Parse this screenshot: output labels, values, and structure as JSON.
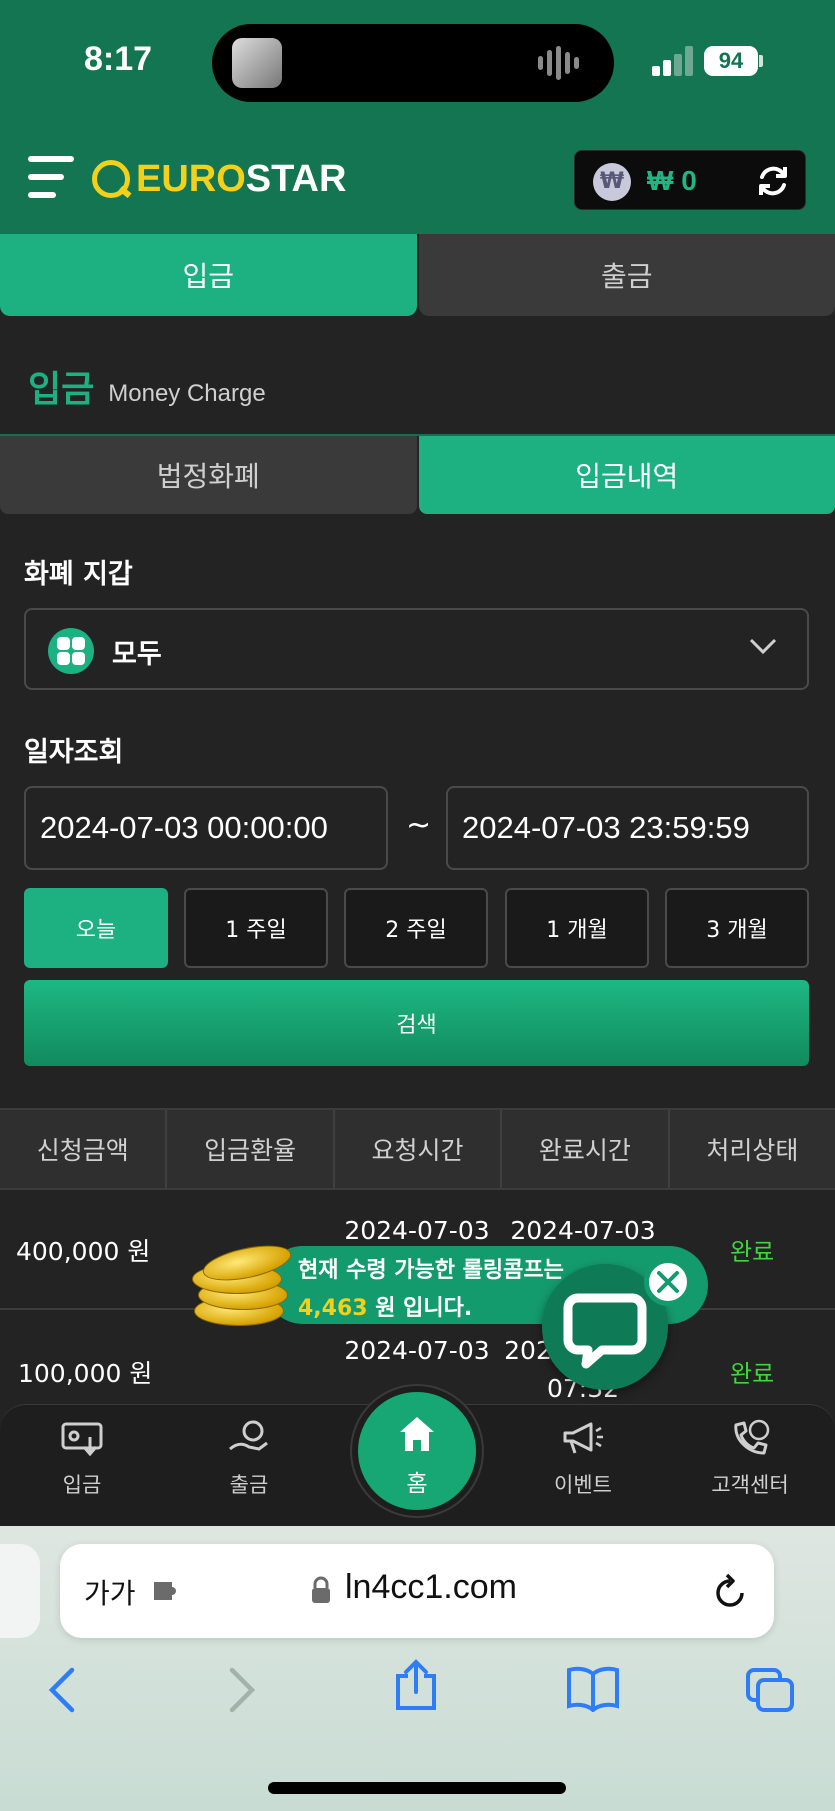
{
  "status": {
    "time": "8:17",
    "battery": "94"
  },
  "header": {
    "logo_part1": "EURO",
    "logo_part2": "STAR",
    "wallet_symbol": "₩",
    "wallet_amount": "₩ 0"
  },
  "main_tabs": {
    "deposit": "입금",
    "withdraw": "출금"
  },
  "section": {
    "title_kr": "입금",
    "title_en": "Money Charge"
  },
  "sub_tabs": {
    "fiat": "법정화폐",
    "history": "입금내역"
  },
  "wallet_filter": {
    "label": "화폐 지갑",
    "selected": "모두"
  },
  "date_query": {
    "label": "일자조회",
    "from": "2024-07-03 00:00:00",
    "to": "2024-07-03 23:59:59",
    "separator": "~"
  },
  "ranges": [
    "오늘",
    "1 주일",
    "2 주일",
    "1 개월",
    "3 개월"
  ],
  "search_label": "검색",
  "table": {
    "headers": [
      "신청금액",
      "입금환율",
      "요청시간",
      "완료시간",
      "처리상태"
    ],
    "rows": [
      {
        "amount": "400,000 원",
        "request": "2024-07-03",
        "complete": "2024-07-03",
        "status": "완료"
      },
      {
        "amount": "100,000 원",
        "request": "2024-07-03",
        "complete": "202",
        "complete_time": "07:32",
        "status": "완료"
      }
    ]
  },
  "comp_popup": {
    "line1": "현재 수령 가능한 롤링콤프는",
    "amount": "4,463",
    "line2_suffix": "원 입니다."
  },
  "bottom_nav": {
    "deposit": "입금",
    "withdraw": "출금",
    "home": "홈",
    "event": "이벤트",
    "support": "고객센터"
  },
  "browser": {
    "aa": "가가",
    "url": "ln4cc1.com"
  },
  "colors": {
    "brand_green": "#137552",
    "accent": "#1db081",
    "logo_yellow": "#f3d11b",
    "status_done": "#3dd63d"
  }
}
